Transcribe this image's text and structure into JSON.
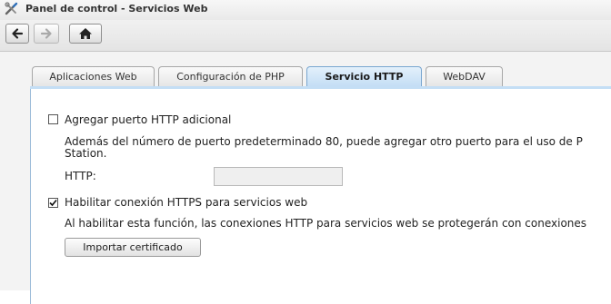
{
  "window": {
    "title": "Panel de control - Servicios Web"
  },
  "toolbar": {
    "back_icon": "arrow-left-icon",
    "forward_icon": "arrow-right-icon",
    "home_icon": "home-icon"
  },
  "tabs": [
    {
      "label": "Aplicaciones Web",
      "active": false
    },
    {
      "label": "Configuración de PHP",
      "active": false
    },
    {
      "label": "Servicio HTTP",
      "active": true
    },
    {
      "label": "WebDAV",
      "active": false
    }
  ],
  "http_port": {
    "checkbox_label": "Agregar puerto HTTP adicional",
    "checked": false,
    "description_line1": "Además del número de puerto predeterminado 80, puede agregar otro puerto para el uso de P",
    "description_line2": "Station.",
    "field_label": "HTTP:",
    "field_value": ""
  },
  "https": {
    "checkbox_label": "Habilitar conexión HTTPS para servicios web",
    "checked": true,
    "description": "Al habilitar esta función, las conexiones HTTP para servicios web se protegerán con conexiones",
    "import_button_label": "Importar certificado"
  },
  "colors": {
    "active_tab": "#c4def5",
    "panel_border": "#9bbbd8"
  }
}
